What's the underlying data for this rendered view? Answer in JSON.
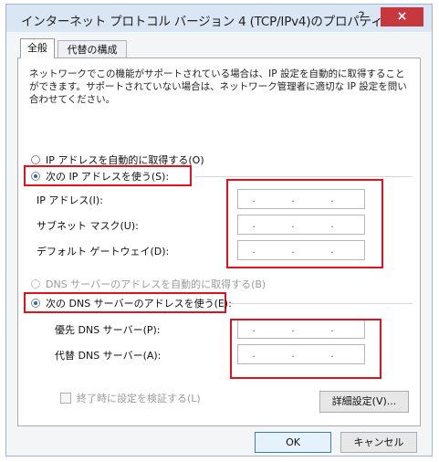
{
  "window": {
    "title": "インターネット プロトコル バージョン 4 (TCP/IPv4)のプロパティ",
    "help_symbol": "?",
    "close_symbol": "×"
  },
  "tabs": [
    {
      "label": "全般",
      "selected": true
    },
    {
      "label": "代替の構成",
      "selected": false
    }
  ],
  "description": "ネットワークでこの機能がサポートされている場合は、IP 設定を自動的に取得することができます。サポートされていない場合は、ネットワーク管理者に適切な IP 設定を問い合わせてください。",
  "ip_section": {
    "auto_label": "IP アドレスを自動的に取得する(O)",
    "manual_label": "次の IP アドレスを使う(S):",
    "manual_selected": true,
    "fields": [
      {
        "label": "IP アドレス(I):",
        "value": ". . ."
      },
      {
        "label": "サブネット マスク(U):",
        "value": ". . ."
      },
      {
        "label": "デフォルト ゲートウェイ(D):",
        "value": ". . ."
      }
    ]
  },
  "dns_section": {
    "auto_label": "DNS サーバーのアドレスを自動的に取得する(B)",
    "manual_label": "次の DNS サーバーのアドレスを使う(E):",
    "manual_selected": true,
    "fields": [
      {
        "label": "優先 DNS サーバー(P):",
        "value": ". . ."
      },
      {
        "label": "代替 DNS サーバー(A):",
        "value": ". . ."
      }
    ]
  },
  "validate_label": "終了時に設定を検証する(L)",
  "validate_checked": false,
  "buttons": {
    "advanced": "詳細設定(V)...",
    "ok": "OK",
    "cancel": "キャンセル"
  },
  "colors": {
    "highlight": "#e3101d",
    "close_button": "#c7383e",
    "titlebar": "#dbe6f4"
  }
}
